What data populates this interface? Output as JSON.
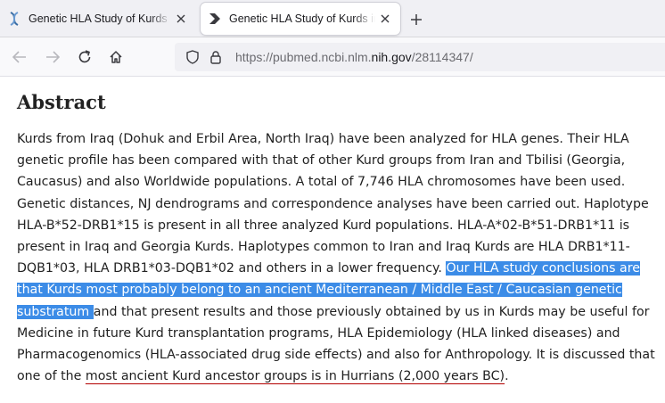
{
  "browser": {
    "tabs": [
      {
        "title": "Genetic HLA Study of Kurds in Iraq",
        "active": false,
        "favicon": "dna-icon"
      },
      {
        "title": "Genetic HLA Study of Kurds in Iraq",
        "active": true,
        "favicon": "forward-arrow-icon"
      }
    ],
    "url_prefix": "https://pubmed.ncbi.nlm.",
    "url_host": "nih.gov",
    "url_path": "/28114347/"
  },
  "page": {
    "heading": "Abstract",
    "abstract_before": "Kurds from Iraq (Dohuk and Erbil Area, North Iraq) have been analyzed for HLA genes. Their HLA genetic profile has been compared with that of other Kurd groups from Iran and Tbilisi (Georgia, Caucasus) and also Worldwide populations. A total of 7,746 HLA chromosomes have been used. Genetic distances, NJ dendrograms and correspondence analyses have been carried out. Haplotype HLA-B*52-DRB1*15 is present in all three analyzed Kurd populations. HLA-A*02-B*51-DRB1*11 is present in Iraq and Georgia Kurds. Haplotypes common to Iran and Iraq Kurds are HLA DRB1*11-DQB1*03, HLA DRB1*03-DQB1*02 and others in a lower frequency. ",
    "abstract_highlight": "Our HLA study conclusions are that Kurds most probably belong to an ancient Mediterranean / Middle East / Caucasian genetic substratum ",
    "abstract_middle": "and that present results and those previously obtained by us in Kurds may be useful for Medicine in future Kurd transplantation programs, HLA Epidemiology (HLA linked diseases) and Pharmacogenomics (HLA-associated drug side effects) and also for Anthropology. It is discussed that one of the ",
    "abstract_underlined": "most ancient Kurd ancestor groups is in Hurrians (2,000 years BC)",
    "abstract_end": "."
  },
  "colors": {
    "highlight": "#3c8ce7",
    "underline": "#b30000"
  }
}
